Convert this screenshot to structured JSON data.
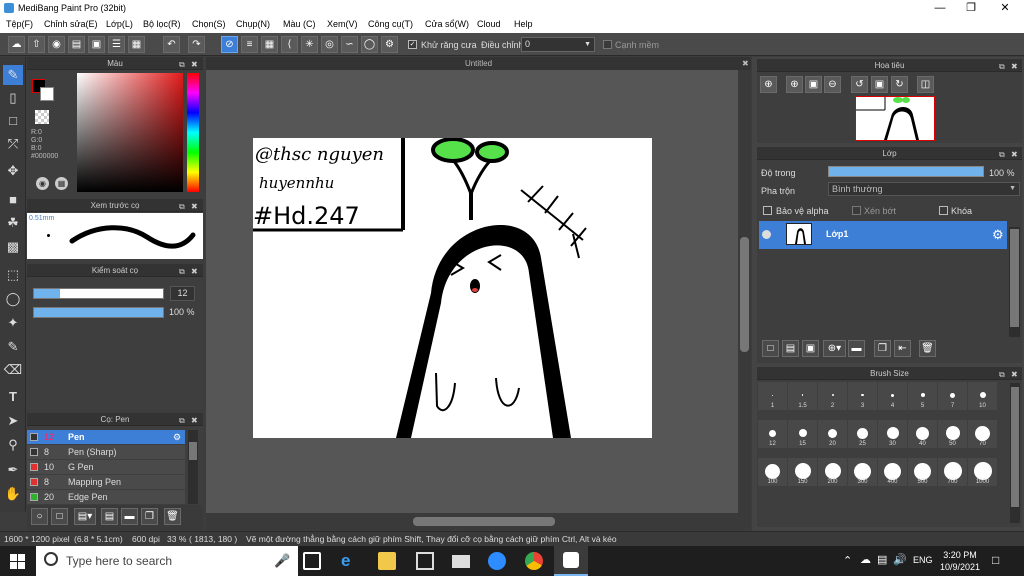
{
  "title": "MediBang Paint Pro (32bit)",
  "menu": [
    "Tệp(F)",
    "Chỉnh sửa(E)",
    "Lớp(L)",
    "Bộ lọc(R)",
    "Chọn(S)",
    "Chụp(N)",
    "Màu (C)",
    "Xem(V)",
    "Công cụ(T)",
    "Cửa sổ(W)",
    "Cloud",
    "Help"
  ],
  "toolbar": {
    "antialias_label": "Khử răng cưa",
    "adjust_label": "Điều chỉnh",
    "adjust_value": "0",
    "edge_label": "Cạnh mềm"
  },
  "panels": {
    "color": {
      "title": "Màu",
      "r": "R:0",
      "g": "G:0",
      "b": "B:0",
      "hex": "#000000"
    },
    "brush_preview": {
      "title": "Xem trước cọ",
      "size": "0.51mm"
    },
    "brush_control": {
      "title": "Kiểm soát cọ",
      "size_value": "12",
      "opacity_value": "100 %",
      "size_fill": 0.2,
      "opacity_fill": 1.0
    },
    "brush_list": {
      "title": "Cọ: Pen",
      "items": [
        {
          "size": "12",
          "name": "Pen",
          "color": "#333333",
          "selected": true
        },
        {
          "size": "8",
          "name": "Pen (Sharp)",
          "color": "#333333",
          "selected": false
        },
        {
          "size": "10",
          "name": "G Pen",
          "color": "#e03030",
          "selected": false
        },
        {
          "size": "8",
          "name": "Mapping Pen",
          "color": "#e03030",
          "selected": false
        },
        {
          "size": "20",
          "name": "Edge Pen",
          "color": "#30b030",
          "selected": false
        }
      ]
    },
    "navigator": {
      "title": "Hoa tiêu"
    },
    "layer": {
      "title": "Lớp",
      "opacity_label": "Độ trong",
      "opacity_value": "100 %",
      "blend_label": "Pha trộn",
      "blend_value": "Bình thường",
      "protect_alpha": "Bảo vệ alpha",
      "clipping": "Xén bớt",
      "lock": "Khóa",
      "layer_name": "Lớp1"
    },
    "brush_size": {
      "title": "Brush Size",
      "sizes": [
        "1",
        "1.5",
        "2",
        "3",
        "4",
        "5",
        "7",
        "10",
        "12",
        "15",
        "20",
        "25",
        "30",
        "40",
        "50",
        "70",
        "100",
        "150",
        "200",
        "300",
        "400",
        "500",
        "700",
        "1000"
      ]
    }
  },
  "canvas_tab": "Untitled",
  "status": {
    "dims": "1600 * 1200 pixel",
    "physical": "(6.8 * 5.1cm)",
    "dpi": "600 dpi",
    "zoom": "33 %",
    "coords": "( 1813, 180 )",
    "hint": "Vẽ một đường thẳng bằng cách giữ phím Shift, Thay đổi cỡ cọ bằng cách giữ phím Ctrl, Alt và kéo"
  },
  "drawing_text": {
    "line1": "@thsc nguyen",
    "line2": "huyennhu",
    "line3": "#Hd.247"
  },
  "taskbar": {
    "search_placeholder": "Type here to search",
    "lang": "ENG",
    "time": "3:20 PM",
    "date": "10/9/2021"
  }
}
